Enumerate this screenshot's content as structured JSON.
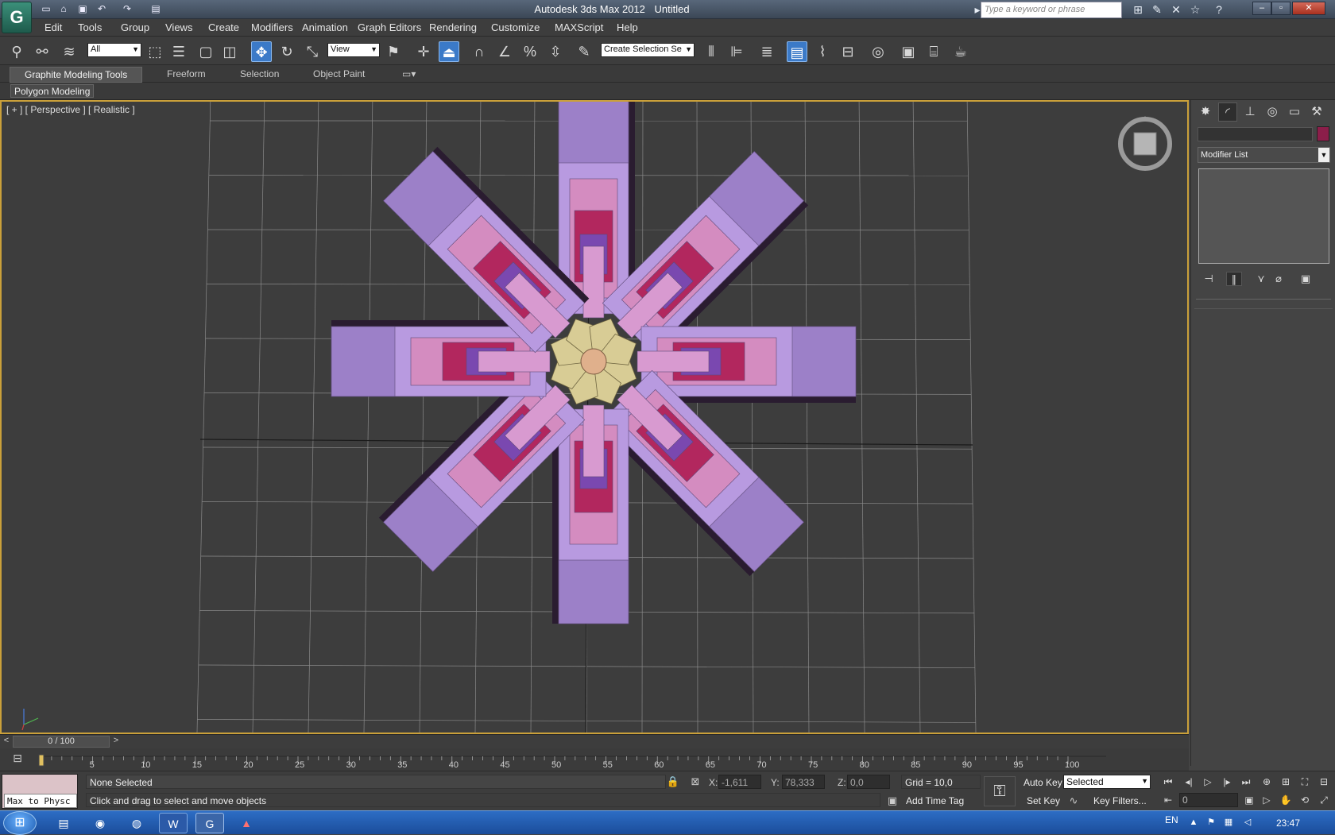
{
  "title": {
    "app": "Autodesk 3ds Max 2012",
    "document": "Untitled"
  },
  "search": {
    "placeholder": "Type a keyword or phrase"
  },
  "menu": [
    "Edit",
    "Tools",
    "Group",
    "Views",
    "Create",
    "Modifiers",
    "Animation",
    "Graph Editors",
    "Rendering",
    "Customize",
    "MAXScript",
    "Help"
  ],
  "toolbar": {
    "selection_filter": "All",
    "reference_coord": "View",
    "named_selection": "Create Selection Se"
  },
  "ribbon": {
    "tabs": [
      "Graphite Modeling Tools",
      "Freeform",
      "Selection",
      "Object Paint"
    ],
    "panel": "Polygon Modeling"
  },
  "viewport": {
    "label": "[ + ] [ Perspective ] [ Realistic ]"
  },
  "command_panel": {
    "modifier_list": "Modifier List",
    "object_color": "#8c1e4a"
  },
  "timeline": {
    "slider_label": "0 / 100",
    "ticks": [
      "5",
      "10",
      "15",
      "20",
      "25",
      "30",
      "35",
      "40",
      "45",
      "50",
      "55",
      "60",
      "65",
      "70",
      "75",
      "80",
      "85",
      "90",
      "95",
      "100"
    ]
  },
  "status": {
    "listener": "Max to Physc",
    "selection": "None Selected",
    "prompt": "Click and drag to select and move objects",
    "x_label": "X:",
    "x_value": "-1,611",
    "y_label": "Y:",
    "y_value": "78,333",
    "z_label": "Z:",
    "z_value": "0,0",
    "grid": "Grid = 10,0",
    "add_time_tag": "Add Time Tag",
    "auto_key": "Auto Key",
    "set_key": "Set Key",
    "key_mode": "Selected",
    "key_filters": "Key Filters...",
    "frame": "0"
  },
  "taskbar": {
    "language": "EN",
    "clock": "23:47"
  },
  "colors": {
    "viewport_bg": "#3d3d3d",
    "active_border": "#caa03a",
    "arm_light": "#b89ae0",
    "arm_pink": "#d48cc0",
    "arm_magenta": "#b2275e",
    "arm_violet": "#7a48b0",
    "hub": "#d8cc95"
  }
}
